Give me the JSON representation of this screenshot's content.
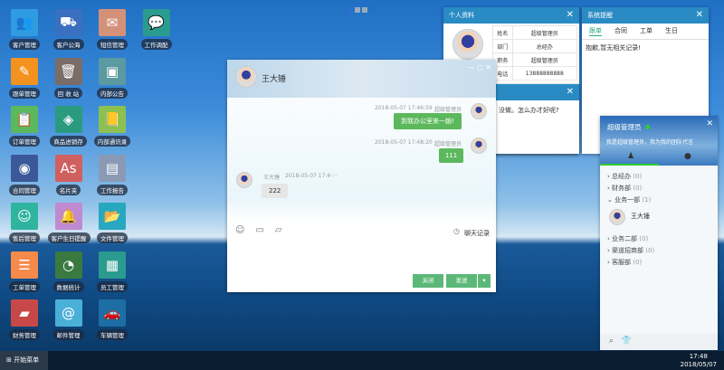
{
  "desktop_icons": [
    {
      "label": "客户管理",
      "color": "#2f9be0",
      "glyph": "👥"
    },
    {
      "label": "客户公海",
      "color": "#3b6fc0",
      "glyph": "⛟"
    },
    {
      "label": "短信管理",
      "color": "#d4917a",
      "glyph": "✉"
    },
    {
      "label": "工作调配",
      "color": "#2a9b8f",
      "glyph": "💬"
    },
    {
      "label": "跟单管理",
      "color": "#f3921e",
      "glyph": "✎"
    },
    {
      "label": "回 收 站",
      "color": "#7a6c66",
      "glyph": "🗑"
    },
    {
      "label": "内部公告",
      "color": "#5a9aa0",
      "glyph": "▣"
    },
    {
      "label": "订单管理",
      "color": "#5cb85c",
      "glyph": "📋"
    },
    {
      "label": "商品进销存",
      "color": "#2a9b7f",
      "glyph": "◈"
    },
    {
      "label": "内部通讯录",
      "color": "#8cc152",
      "glyph": "📒"
    },
    {
      "label": "合同管理",
      "color": "#3b5998",
      "glyph": "◉"
    },
    {
      "label": "名片夹",
      "color": "#d06060",
      "glyph": "As"
    },
    {
      "label": "工作报告",
      "color": "#8a9ab5",
      "glyph": "▤"
    },
    {
      "label": "售后管理",
      "color": "#2fb4a0",
      "glyph": "☺"
    },
    {
      "label": "客户生日提醒",
      "color": "#c08ad0",
      "glyph": "🔔"
    },
    {
      "label": "文件管理",
      "color": "#27a8c0",
      "glyph": "📂"
    },
    {
      "label": "工单管理",
      "color": "#f58a4a",
      "glyph": "☰"
    },
    {
      "label": "数据统计",
      "color": "#3a7a40",
      "glyph": "◔"
    },
    {
      "label": "员工管理",
      "color": "#2a9b8f",
      "glyph": "▦"
    },
    {
      "label": "财务管理",
      "color": "#c84848",
      "glyph": "▰"
    },
    {
      "label": "邮件管理",
      "color": "#4ab0d8",
      "glyph": "@"
    },
    {
      "label": "车辆管理",
      "color": "#1c6ea4",
      "glyph": "🚗"
    }
  ],
  "profile": {
    "title": "个人资料",
    "rows": [
      [
        "姓名",
        "超级管理员"
      ],
      [
        "部门",
        "总经办"
      ],
      [
        "职务",
        "超级管理员"
      ],
      [
        "电话",
        "13888888888"
      ]
    ]
  },
  "back_window": {
    "text": "没做。怎么办才好呢?"
  },
  "reminder": {
    "title": "系统提醒",
    "tabs": [
      "跟单",
      "合同",
      "工单",
      "生日"
    ],
    "empty": "抱歉,暂无相关记录!"
  },
  "chat": {
    "title": "王大锤",
    "messages": [
      {
        "time": "2018-05-07 17:46:59",
        "sender": "超级管理员",
        "text": "到我办公室来一趟!"
      },
      {
        "time": "2018-05-07 17:48:20",
        "sender": "超级管理员",
        "text": "111"
      },
      {
        "time": "2018-05-07 17:4·:··",
        "sender": "王大锤",
        "text": "222"
      }
    ],
    "history": "聊天记录",
    "close": "关闭",
    "send": "发送"
  },
  "contacts": {
    "title": "超级管理员",
    "motto": "我是超级管理员，我为我的团队代言",
    "depts": [
      {
        "name": "总经办",
        "count": "(0)"
      },
      {
        "name": "财务部",
        "count": "(0)"
      },
      {
        "name": "业务一部",
        "count": "(1)"
      },
      {
        "name": "业务二部",
        "count": "(0)"
      },
      {
        "name": "渠道招商部",
        "count": "(0)"
      },
      {
        "name": "客服部",
        "count": "(0)"
      }
    ],
    "member": "王大锤"
  },
  "taskbar": {
    "start": "开始菜单",
    "time": "17:48",
    "date": "2018/05/07"
  }
}
